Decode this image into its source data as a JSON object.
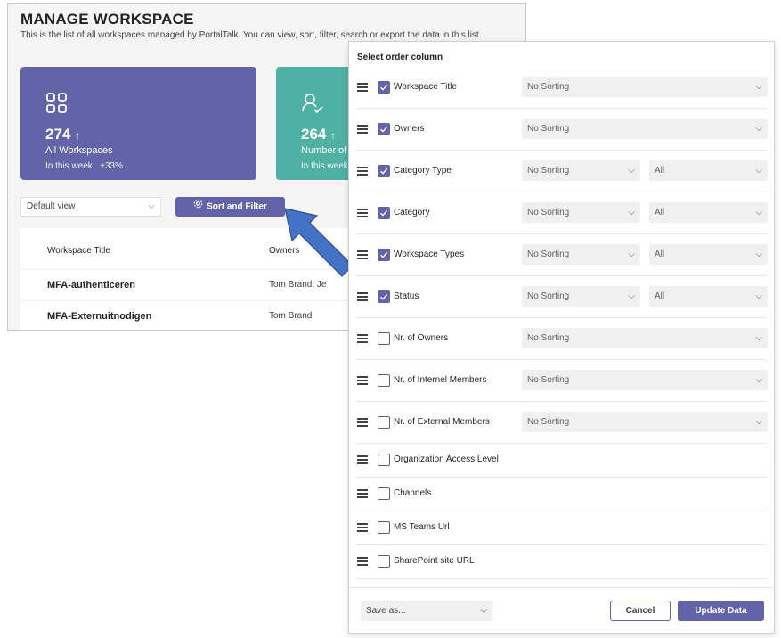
{
  "background": {
    "title": "MANAGE WORKSPACE",
    "subtitle": "This is the list of all workspaces managed by PortalTalk. You can view, sort, filter, search or export the data in this list.",
    "cards": [
      {
        "icon": "grid-icon",
        "value": "274",
        "trend": "↑",
        "label": "All Workspaces",
        "week": "In this week",
        "change": "+33%",
        "color": "#6264a7"
      },
      {
        "icon": "person-check-icon",
        "value": "264",
        "trend": "↑",
        "label": "Number of",
        "week": "In this week",
        "color": "#4fb0a4"
      }
    ],
    "view_select": {
      "value": "Default view"
    },
    "sort_filter_label": "Sort and Filter",
    "table": {
      "headers": [
        "Workspace Title",
        "Owners"
      ],
      "rows": [
        {
          "title": "MFA-authenticeren",
          "owners": "Tom Brand, Je"
        },
        {
          "title": "MFA-Externuitnodigen",
          "owners": "Tom Brand"
        }
      ]
    }
  },
  "dialog": {
    "heading": "Select order column",
    "columns": [
      {
        "label": "Workspace Title",
        "checked": true,
        "sort": "No Sorting"
      },
      {
        "label": "Owners",
        "checked": true,
        "sort": "No Sorting"
      },
      {
        "label": "Category Type",
        "checked": true,
        "sort": "No Sorting",
        "filter": "All"
      },
      {
        "label": "Category",
        "checked": true,
        "sort": "No Sorting",
        "filter": "All"
      },
      {
        "label": "Workspace Types",
        "checked": true,
        "sort": "No Sorting",
        "filter": "All"
      },
      {
        "label": "Status",
        "checked": true,
        "sort": "No Sorting",
        "filter": "All"
      },
      {
        "label": "Nr. of Owners",
        "checked": false,
        "sort": "No Sorting"
      },
      {
        "label": "Nr. of Internel Members",
        "checked": false,
        "sort": "No Sorting"
      },
      {
        "label": "Nr. of External Members",
        "checked": false,
        "sort": "No Sorting"
      },
      {
        "label": "Organization Access Level",
        "checked": false
      },
      {
        "label": "Channels",
        "checked": false
      },
      {
        "label": "MS Teams Url",
        "checked": false
      },
      {
        "label": "SharePoint site URL",
        "checked": false
      }
    ],
    "save_as_placeholder": "Save as...",
    "cancel_label": "Cancel",
    "update_label": "Update Data"
  },
  "colors": {
    "accent": "#6264a7",
    "teal": "#4fb0a4",
    "arrow": "#4472c4"
  }
}
